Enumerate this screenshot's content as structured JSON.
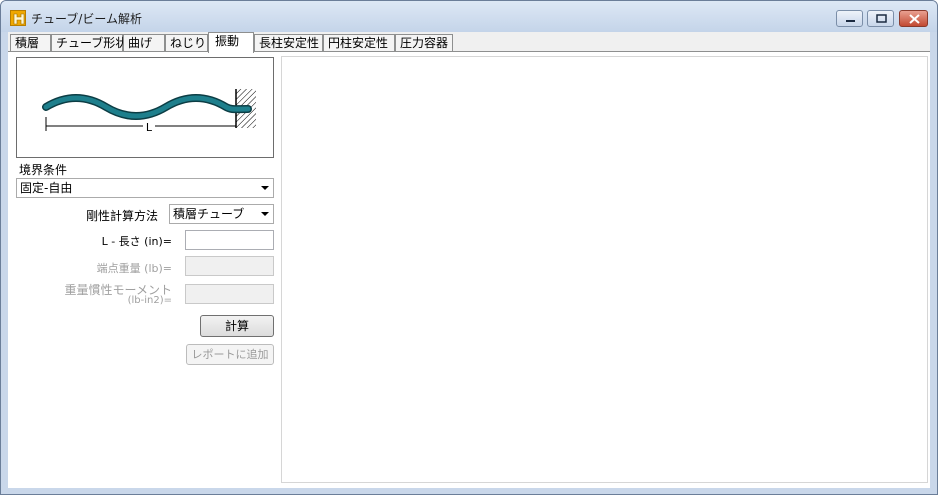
{
  "window": {
    "title": "チューブ/ビーム解析",
    "icon": "app-logo-icon"
  },
  "tabs": [
    {
      "label": "積層",
      "active": false
    },
    {
      "label": "チューブ形状",
      "active": false
    },
    {
      "label": "曲げ",
      "active": false
    },
    {
      "label": "ねじり",
      "active": false
    },
    {
      "label": "振動",
      "active": true
    },
    {
      "label": "長柱安定性",
      "active": false
    },
    {
      "label": "円柱安定性",
      "active": false
    },
    {
      "label": "圧力容器",
      "active": false
    }
  ],
  "diagram": {
    "length_label": "L",
    "tube_color": "#1e7f8c"
  },
  "form": {
    "boundary_label": "境界条件",
    "boundary_value": "固定-自由",
    "stiffness_label": "剛性計算方法",
    "stiffness_value": "積層チューブ",
    "length_label": "L - 長さ (in)=",
    "length_value": "",
    "end_weight_label": "端点重量 (lb)=",
    "end_weight_value": "",
    "inertia_label_1": "重量慣性モーメント",
    "inertia_label_2": "(lb-in2)=",
    "inertia_value": ""
  },
  "buttons": {
    "calculate": "計算",
    "add_report": "レポートに追加"
  }
}
